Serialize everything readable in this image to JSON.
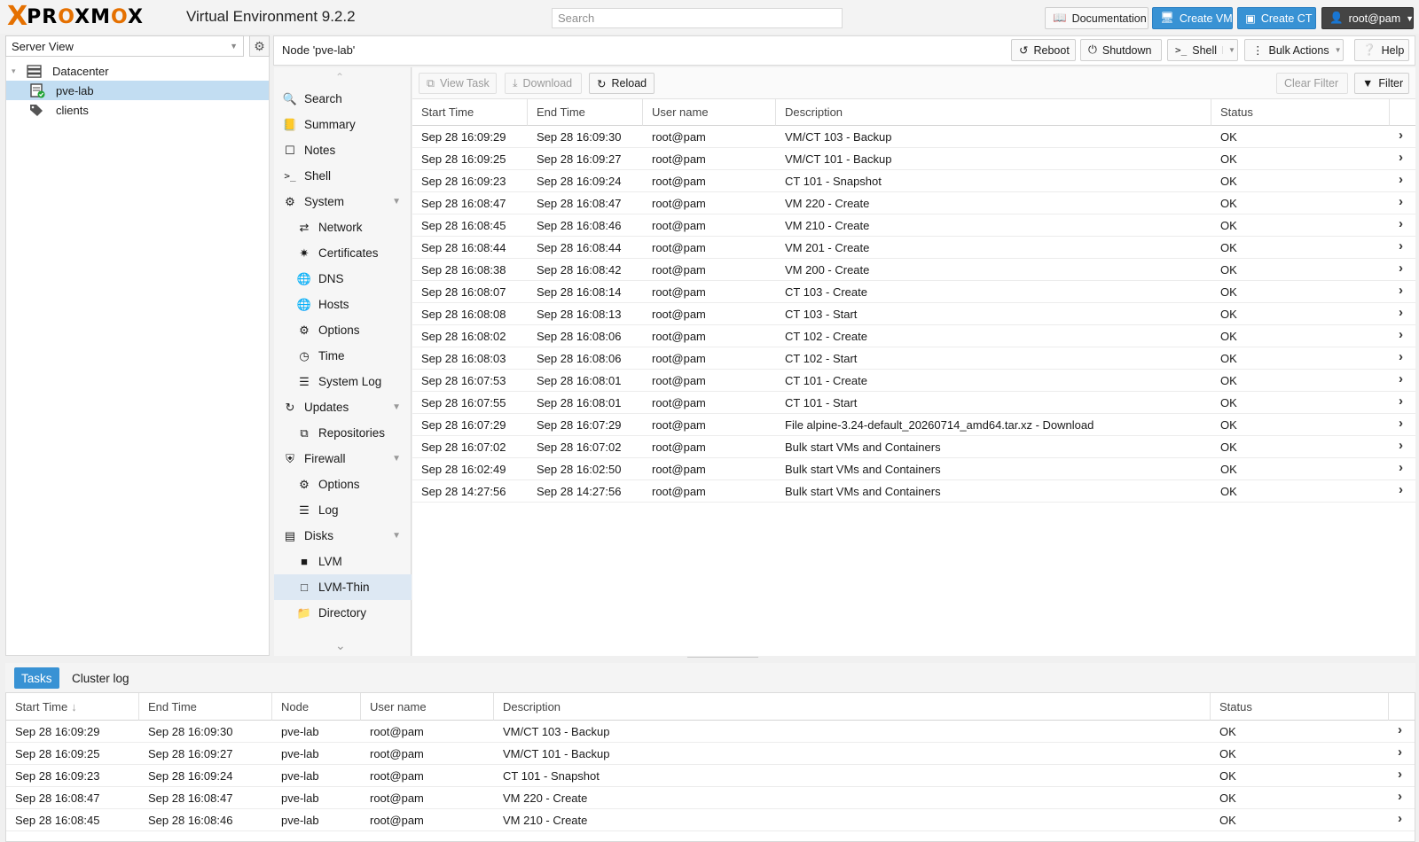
{
  "topbar": {
    "logo_text": "PROXMOX",
    "version": "Virtual Environment 9.2.2",
    "search_placeholder": "Search",
    "buttons": {
      "documentation": "Documentation",
      "create_vm": "Create VM",
      "create_ct": "Create CT",
      "user": "root@pam"
    }
  },
  "tree": {
    "view": "Server View",
    "items": [
      {
        "label": "Datacenter"
      },
      {
        "label": "pve-lab"
      },
      {
        "label": "clients"
      }
    ]
  },
  "node": {
    "title": "Node 'pve-lab'",
    "buttons": {
      "reboot": "Reboot",
      "shutdown": "Shutdown",
      "shell": "Shell",
      "bulk": "Bulk Actions",
      "help": "Help"
    }
  },
  "nav": [
    {
      "label": "Search",
      "icon": "search-icon"
    },
    {
      "label": "Summary",
      "icon": "book-icon"
    },
    {
      "label": "Notes",
      "icon": "note-icon"
    },
    {
      "label": "Shell",
      "icon": "terminal-icon"
    },
    {
      "label": "System",
      "icon": "cogs-icon"
    },
    {
      "label": "Network",
      "icon": "exchange-icon"
    },
    {
      "label": "Certificates",
      "icon": "certificate-icon"
    },
    {
      "label": "DNS",
      "icon": "globe-icon"
    },
    {
      "label": "Hosts",
      "icon": "globe-icon"
    },
    {
      "label": "Options",
      "icon": "gear-icon"
    },
    {
      "label": "Time",
      "icon": "clock-icon"
    },
    {
      "label": "System Log",
      "icon": "list-icon"
    },
    {
      "label": "Updates",
      "icon": "refresh-icon"
    },
    {
      "label": "Repositories",
      "icon": "files-icon"
    },
    {
      "label": "Firewall",
      "icon": "shield-icon"
    },
    {
      "label": "Options",
      "icon": "gear-icon"
    },
    {
      "label": "Log",
      "icon": "list-icon"
    },
    {
      "label": "Disks",
      "icon": "hdd-icon"
    },
    {
      "label": "LVM",
      "icon": "square-icon"
    },
    {
      "label": "LVM-Thin",
      "icon": "square-outline-icon"
    },
    {
      "label": "Directory",
      "icon": "folder-icon"
    }
  ],
  "grid": {
    "toolbar": {
      "view_task": "View Task",
      "download": "Download",
      "reload": "Reload",
      "clear_filter": "Clear Filter",
      "filter": "Filter"
    },
    "columns": [
      "Start Time",
      "End Time",
      "User name",
      "Description",
      "Status"
    ],
    "rows": [
      [
        "Sep 28 16:09:29",
        "Sep 28 16:09:30",
        "root@pam",
        "VM/CT 103 - Backup",
        "OK"
      ],
      [
        "Sep 28 16:09:25",
        "Sep 28 16:09:27",
        "root@pam",
        "VM/CT 101 - Backup",
        "OK"
      ],
      [
        "Sep 28 16:09:23",
        "Sep 28 16:09:24",
        "root@pam",
        "CT 101 - Snapshot",
        "OK"
      ],
      [
        "Sep 28 16:08:47",
        "Sep 28 16:08:47",
        "root@pam",
        "VM 220 - Create",
        "OK"
      ],
      [
        "Sep 28 16:08:45",
        "Sep 28 16:08:46",
        "root@pam",
        "VM 210 - Create",
        "OK"
      ],
      [
        "Sep 28 16:08:44",
        "Sep 28 16:08:44",
        "root@pam",
        "VM 201 - Create",
        "OK"
      ],
      [
        "Sep 28 16:08:38",
        "Sep 28 16:08:42",
        "root@pam",
        "VM 200 - Create",
        "OK"
      ],
      [
        "Sep 28 16:08:07",
        "Sep 28 16:08:14",
        "root@pam",
        "CT 103 - Create",
        "OK"
      ],
      [
        "Sep 28 16:08:08",
        "Sep 28 16:08:13",
        "root@pam",
        "CT 103 - Start",
        "OK"
      ],
      [
        "Sep 28 16:08:02",
        "Sep 28 16:08:06",
        "root@pam",
        "CT 102 - Create",
        "OK"
      ],
      [
        "Sep 28 16:08:03",
        "Sep 28 16:08:06",
        "root@pam",
        "CT 102 - Start",
        "OK"
      ],
      [
        "Sep 28 16:07:53",
        "Sep 28 16:08:01",
        "root@pam",
        "CT 101 - Create",
        "OK"
      ],
      [
        "Sep 28 16:07:55",
        "Sep 28 16:08:01",
        "root@pam",
        "CT 101 - Start",
        "OK"
      ],
      [
        "Sep 28 16:07:29",
        "Sep 28 16:07:29",
        "root@pam",
        "File alpine-3.24-default_20260714_amd64.tar.xz - Download",
        "OK"
      ],
      [
        "Sep 28 16:07:02",
        "Sep 28 16:07:02",
        "root@pam",
        "Bulk start VMs and Containers",
        "OK"
      ],
      [
        "Sep 28 16:02:49",
        "Sep 28 16:02:50",
        "root@pam",
        "Bulk start VMs and Containers",
        "OK"
      ],
      [
        "Sep 28 14:27:56",
        "Sep 28 14:27:56",
        "root@pam",
        "Bulk start VMs and Containers",
        "OK"
      ]
    ]
  },
  "log": {
    "tabs": [
      "Tasks",
      "Cluster log"
    ],
    "columns": [
      "Start Time",
      "End Time",
      "Node",
      "User name",
      "Description",
      "Status"
    ],
    "rows": [
      [
        "Sep 28 16:09:29",
        "Sep 28 16:09:30",
        "pve-lab",
        "root@pam",
        "VM/CT 103 - Backup",
        "OK"
      ],
      [
        "Sep 28 16:09:25",
        "Sep 28 16:09:27",
        "pve-lab",
        "root@pam",
        "VM/CT 101 - Backup",
        "OK"
      ],
      [
        "Sep 28 16:09:23",
        "Sep 28 16:09:24",
        "pve-lab",
        "root@pam",
        "CT 101 - Snapshot",
        "OK"
      ],
      [
        "Sep 28 16:08:47",
        "Sep 28 16:08:47",
        "pve-lab",
        "root@pam",
        "VM 220 - Create",
        "OK"
      ],
      [
        "Sep 28 16:08:45",
        "Sep 28 16:08:46",
        "pve-lab",
        "root@pam",
        "VM 210 - Create",
        "OK"
      ]
    ]
  },
  "colors": {
    "accent": "#3892d4",
    "brand": "#e57000",
    "selection": "#c2ddf2"
  }
}
